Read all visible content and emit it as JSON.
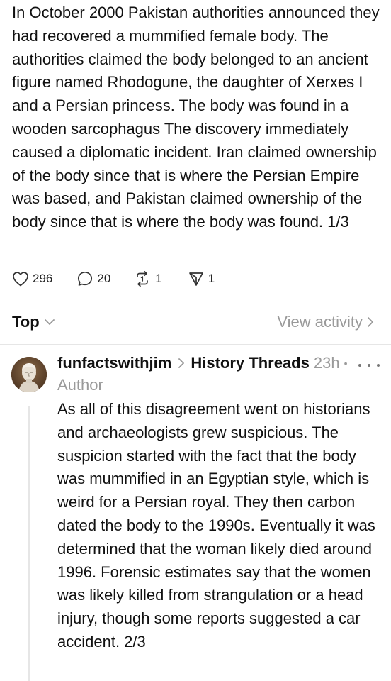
{
  "post": {
    "text": "In October 2000 Pakistan authorities announced they had recovered a mummified female body. The authorities claimed the body belonged to an ancient figure named Rhodogune, the daughter of Xerxes I and a Persian princess. The body was found in a wooden sarcophagus The discovery immediately caused a diplomatic incident. Iran claimed ownership of the body since that is where the Persian Empire was based, and Pakistan claimed ownership of the body since that is where the body was found. 1/3",
    "actions": {
      "likes": "296",
      "replies": "20",
      "reposts": "1",
      "shares": "1"
    },
    "icons": [
      "heart-icon",
      "comment-icon",
      "repost-icon",
      "share-icon"
    ]
  },
  "sort_bar": {
    "sort_label": "Top",
    "view_activity_label": "View activity"
  },
  "reply": {
    "username": "funfactswithjim",
    "community": "History Threads",
    "time": "23h",
    "dot": "•",
    "author_tag": "Author",
    "text": "As all of this disagreement went on historians and archaeologists grew suspicious. The suspicion started with the fact that the body was mummified in an Egyptian style, which is weird for a Persian royal. They then carbon dated the body to the 1990s. Eventually it was determined that the woman likely died around 1996. Forensic estimates say that the women was likely killed from strangulation or a head injury, though some reports suggested a car accident. 2/3"
  },
  "colors": {
    "text": "#111111",
    "muted": "#9a9a9a",
    "divider": "#e6e6e6"
  }
}
